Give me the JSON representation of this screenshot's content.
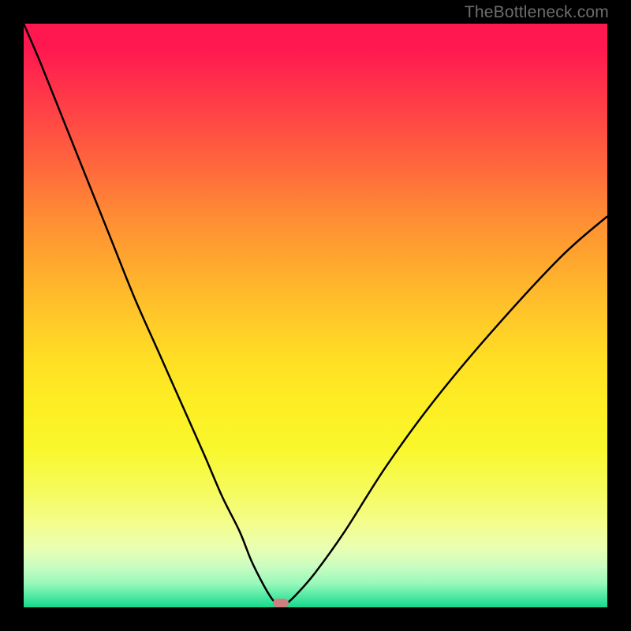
{
  "watermark": "TheBottleneck.com",
  "colors": {
    "frame": "#000000",
    "curve_stroke": "#000000",
    "marker": "#cf7f7f",
    "gradient_top": "#ff1750",
    "gradient_bottom": "#17d98c"
  },
  "chart_data": {
    "type": "line",
    "title": "",
    "xlabel": "",
    "ylabel": "",
    "xlim": [
      0,
      100
    ],
    "ylim": [
      0,
      100
    ],
    "x": [
      0,
      3,
      7,
      11,
      15,
      19,
      23,
      27,
      31,
      34,
      37,
      39,
      41,
      42.5,
      43.5,
      44,
      45,
      47,
      50,
      55,
      62,
      70,
      80,
      92,
      100
    ],
    "values": [
      100,
      93,
      83,
      73,
      63,
      53,
      44,
      35,
      26,
      19,
      13,
      8,
      4,
      1.5,
      0.5,
      0.2,
      0.6,
      2.5,
      6,
      13,
      24,
      35,
      47,
      60,
      67
    ],
    "minimum": {
      "x": 44,
      "y": 0
    },
    "series": [
      {
        "name": "bottleneck-curve",
        "x_key": "x",
        "y_key": "values"
      }
    ],
    "annotations": [
      {
        "name": "optimal-marker",
        "x": 44,
        "y": 0
      }
    ]
  }
}
